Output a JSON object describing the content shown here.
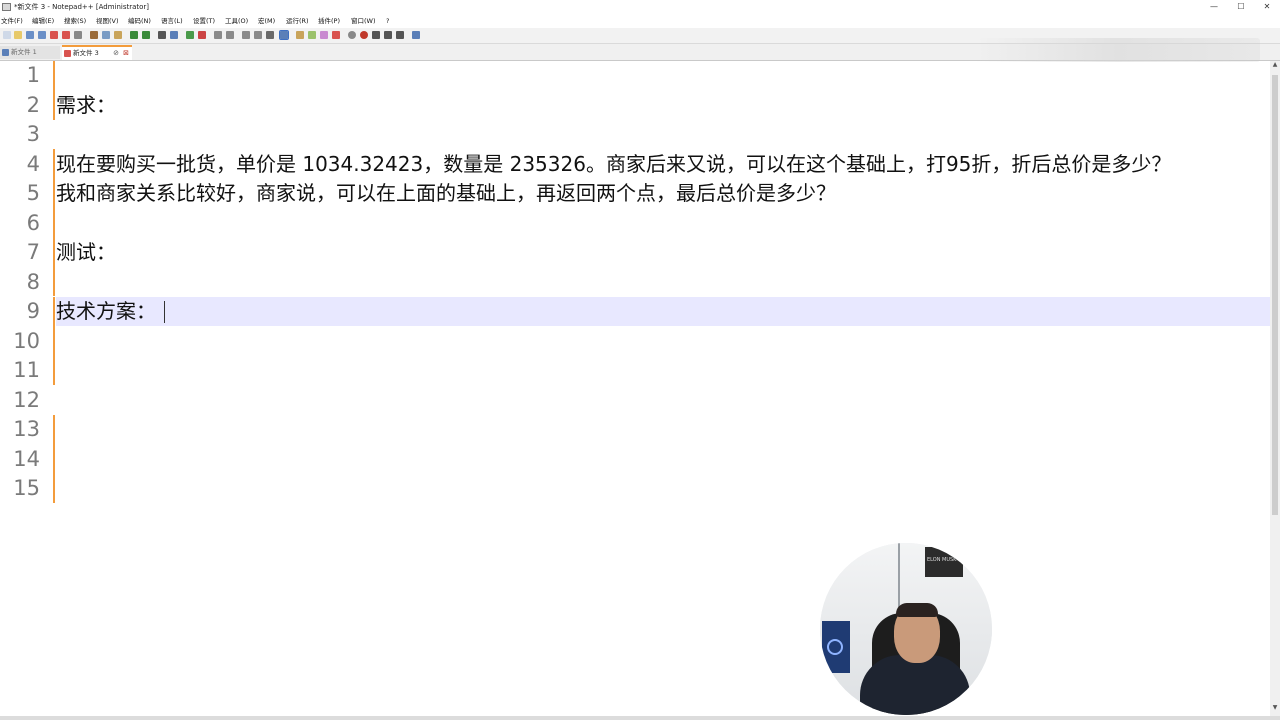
{
  "window": {
    "title": "*新文件 3 - Notepad++ [Administrator]",
    "controls": [
      "—",
      "☐",
      "✕"
    ]
  },
  "menu": [
    "文件(F)",
    "编辑(E)",
    "搜索(S)",
    "视图(V)",
    "编码(N)",
    "语言(L)",
    "设置(T)",
    "工具(O)",
    "宏(M)",
    "运行(R)",
    "插件(P)",
    "窗口(W)",
    "?"
  ],
  "tabs": [
    {
      "label": "新文件 1",
      "active": false
    },
    {
      "label": "新文件 3",
      "active": true
    }
  ],
  "editor": {
    "lines": [
      "",
      "需求：",
      "",
      "现在要购买一批货，单价是 1034.32423，数量是 235326。商家后来又说，可以在这个基础上，打95折，折后总价是多少？",
      "我和商家关系比较好，商家说，可以在上面的基础上，再返回两个点，最后总价是多少？",
      "",
      "测试：",
      "",
      "技术方案：",
      "",
      "",
      "",
      "",
      "",
      ""
    ],
    "line_numbers": [
      "1",
      "2",
      "3",
      "4",
      "5",
      "6",
      "7",
      "8",
      "9",
      "10",
      "11",
      "12",
      "13",
      "14",
      "15"
    ],
    "current_line": 9,
    "colors": {
      "current_line_bg": "#e8e8ff",
      "modified_margin": "#f39c3c",
      "line_number": "#7a7a7a"
    }
  },
  "webcam": {
    "poster_text": "ELON MUSK",
    "banner_text": "AI"
  }
}
